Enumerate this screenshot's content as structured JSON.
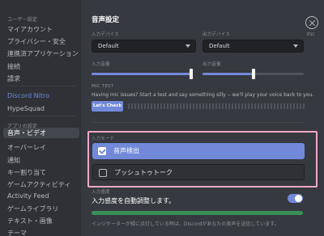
{
  "sidebar": {
    "user_settings_header": "ユーザー設定",
    "items_user": [
      "マイアカウント",
      "プライバシー・安全",
      "連携済アプリケーション",
      "接続",
      "請求"
    ],
    "nitro": "Discord Nitro",
    "hypesquad": "HypeSquad",
    "app_settings_header": "アプリの設定",
    "items_app": [
      "音声・ビデオ",
      "オーバーレイ",
      "通知",
      "キー割り当て",
      "ゲームアクティビティ",
      "Activity Feed",
      "ゲームライブラリ",
      "テキスト・画像",
      "テーマ"
    ],
    "active_item": "音声・ビデオ"
  },
  "main": {
    "title": "音声設定",
    "input_device_label": "入力デバイス",
    "input_device_value": "Default",
    "output_device_label": "出力デバイス",
    "output_device_value": "Default",
    "input_volume_label": "入力音量",
    "input_volume": 1.0,
    "output_volume_label": "出力音量",
    "output_volume": 0.5,
    "mic_test_label": "MIC TEST",
    "mic_test_desc": "Having mic issues? Start a test and say something silly -- we'll play your voice back to you.",
    "lets_check_button": "Let's Check",
    "input_mode_label": "入力モード",
    "mode_voice": "音声検出",
    "mode_ptt": "プッシュトゥトーク",
    "sensitivity_label": "入力感度",
    "auto_sensitivity": "入力感度を自動調整します。",
    "auto_sensitivity_on": true,
    "sensitivity_note": "インジケーターが緑に点灯している時は、Discordがあなたの美声を送信しています。",
    "close_label": "ESC"
  },
  "colors": {
    "accent": "#7289da",
    "highlight_border": "#f2a8c8",
    "sensitivity_green": "#3ba55c"
  },
  "icons": [
    "close-icon",
    "checkbox-checked-icon",
    "checkbox-empty-icon",
    "chevron-down-icon"
  ]
}
